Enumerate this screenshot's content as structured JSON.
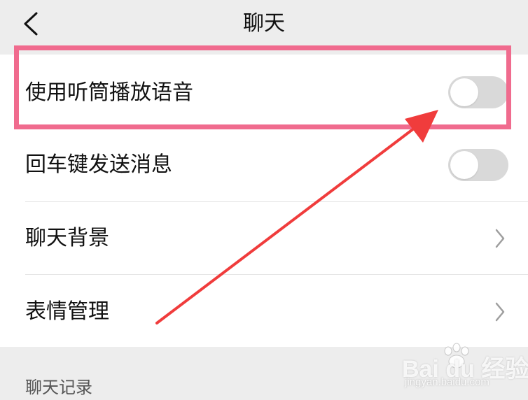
{
  "header": {
    "title": "聊天",
    "back_icon": "chevron-left-icon"
  },
  "settings": [
    {
      "label": "使用听筒播放语音",
      "type": "toggle",
      "on": false
    },
    {
      "label": "回车键发送消息",
      "type": "toggle",
      "on": false
    },
    {
      "label": "聊天背景",
      "type": "link",
      "icon": "chevron-right-icon"
    },
    {
      "label": "表情管理",
      "type": "link",
      "icon": "chevron-right-icon"
    }
  ],
  "section_header": "聊天记录",
  "annotation": {
    "highlight_color": "#f06b8e",
    "arrow_color": "#f03c3c"
  },
  "watermark": {
    "main": "Bai du 经验",
    "sub": "jingyan.baidu.com"
  },
  "colors": {
    "background": "#ededed",
    "card": "#ffffff",
    "toggle_off": "#d9d9d9",
    "text": "#111111"
  }
}
